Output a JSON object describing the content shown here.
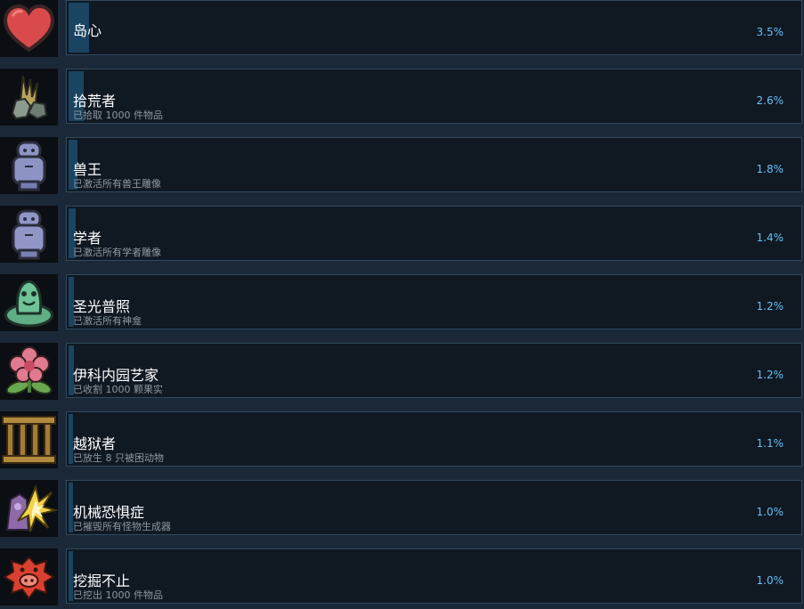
{
  "achievements": [
    {
      "title": "岛心",
      "description": "",
      "percent_label": "3.5%",
      "percent": 3.5,
      "icon": "heart-icon"
    },
    {
      "title": "拾荒者",
      "description": "已拾取 1000 件物品",
      "percent_label": "2.6%",
      "percent": 2.6,
      "icon": "scavenger-icon"
    },
    {
      "title": "兽王",
      "description": "已激活所有兽王雕像",
      "percent_label": "1.8%",
      "percent": 1.8,
      "icon": "beast-statue-icon"
    },
    {
      "title": "学者",
      "description": "已激活所有学者雕像",
      "percent_label": "1.4%",
      "percent": 1.4,
      "icon": "scholar-statue-icon"
    },
    {
      "title": "圣光普照",
      "description": "已激活所有神龛",
      "percent_label": "1.2%",
      "percent": 1.2,
      "icon": "shrine-icon"
    },
    {
      "title": "伊科内园艺家",
      "description": "已收割 1000 颗果实",
      "percent_label": "1.2%",
      "percent": 1.2,
      "icon": "flower-icon"
    },
    {
      "title": "越狱者",
      "description": "已放生 8 只被困动物",
      "percent_label": "1.1%",
      "percent": 1.1,
      "icon": "cage-icon"
    },
    {
      "title": "机械恐惧症",
      "description": "已摧毁所有怪物生成器",
      "percent_label": "1.0%",
      "percent": 1.0,
      "icon": "spawner-explosion-icon"
    },
    {
      "title": "挖掘不止",
      "description": "已挖出 1000 件物品",
      "percent_label": "1.0%",
      "percent": 1.0,
      "icon": "digging-icon"
    }
  ],
  "colors": {
    "background": "#1b2838",
    "panel": "#101822",
    "panel_border": "#2f4a5e",
    "progress": "#1a4462",
    "title": "#ffffff",
    "description": "#8f98a0",
    "percent": "#66c0f4"
  }
}
